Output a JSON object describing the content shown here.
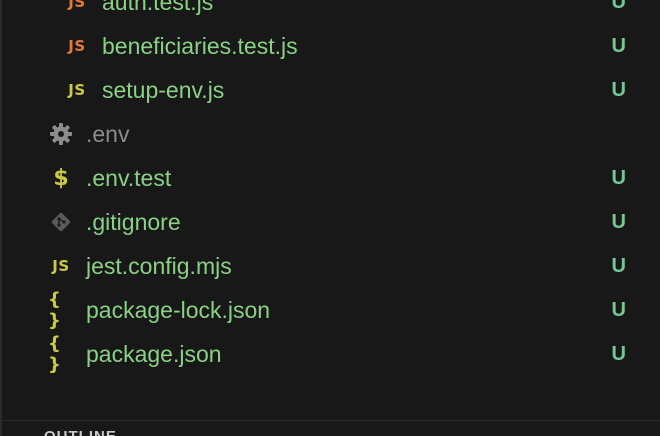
{
  "explorer": {
    "files": [
      {
        "name": "auth.test.js",
        "icon": "js-icon",
        "icon_text": "JS",
        "status": "U"
      },
      {
        "name": "beneficiaries.test.js",
        "icon": "js-icon",
        "icon_text": "JS",
        "status": "U"
      },
      {
        "name": "setup-env.js",
        "icon": "js-icon",
        "icon_text": "JS",
        "status": "U"
      },
      {
        "name": ".env",
        "icon": "gear-icon",
        "status": ""
      },
      {
        "name": ".env.test",
        "icon": "dollar-icon",
        "icon_text": "$",
        "status": "U"
      },
      {
        "name": ".gitignore",
        "icon": "git-icon",
        "status": "U"
      },
      {
        "name": "jest.config.mjs",
        "icon": "js-icon",
        "icon_text": "JS",
        "status": "U"
      },
      {
        "name": "package-lock.json",
        "icon": "json-braces-icon",
        "icon_text": "{ }",
        "status": "U"
      },
      {
        "name": "package.json",
        "icon": "json-braces-icon",
        "icon_text": "{ }",
        "status": "U"
      }
    ]
  },
  "outline": {
    "title": "OUTLINE"
  },
  "colors": {
    "untracked_green": "#89d185",
    "status_green": "#73c991",
    "js_orange": "#e37933",
    "js_yellow": "#cbcb41",
    "ignored_gray": "#8c8c8c"
  }
}
